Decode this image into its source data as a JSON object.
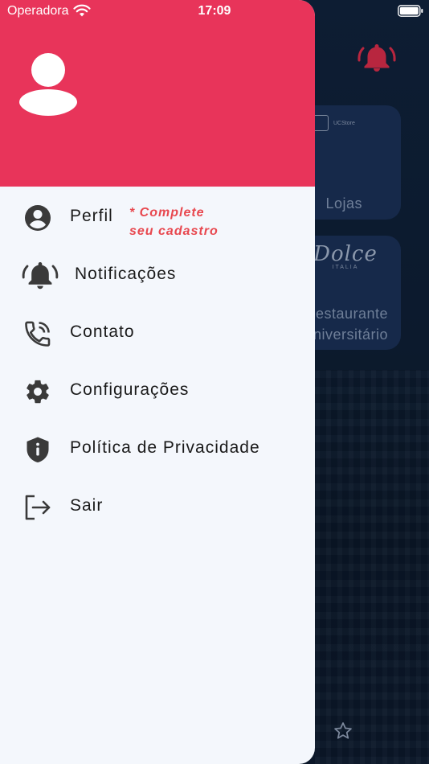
{
  "status_bar": {
    "carrier": "Operadora",
    "time": "17:09"
  },
  "drawer": {
    "header_color": "#e8345a",
    "menu": [
      {
        "id": "perfil",
        "label": "Perfil",
        "icon": "account-circle-icon",
        "note_line1": "* Complete",
        "note_line2": "seu cadastro"
      },
      {
        "id": "notificacoes",
        "label": "Notificações",
        "icon": "bell-ringing-icon"
      },
      {
        "id": "contato",
        "label": "Contato",
        "icon": "phone-in-talk-icon"
      },
      {
        "id": "configuracoes",
        "label": "Configurações",
        "icon": "gear-icon"
      },
      {
        "id": "politica",
        "label": "Política de Privacidade",
        "icon": "shield-info-icon"
      },
      {
        "id": "sair",
        "label": "Sair",
        "icon": "logout-icon"
      }
    ]
  },
  "background": {
    "cards": [
      {
        "label": "Lojas",
        "logo_text": "UCStore"
      },
      {
        "label_line1": "estaurante",
        "label_line2": "niversitário",
        "logo_text": "Dolce",
        "logo_sub": "ITALIA"
      }
    ],
    "accent_color": "#e8345a"
  }
}
